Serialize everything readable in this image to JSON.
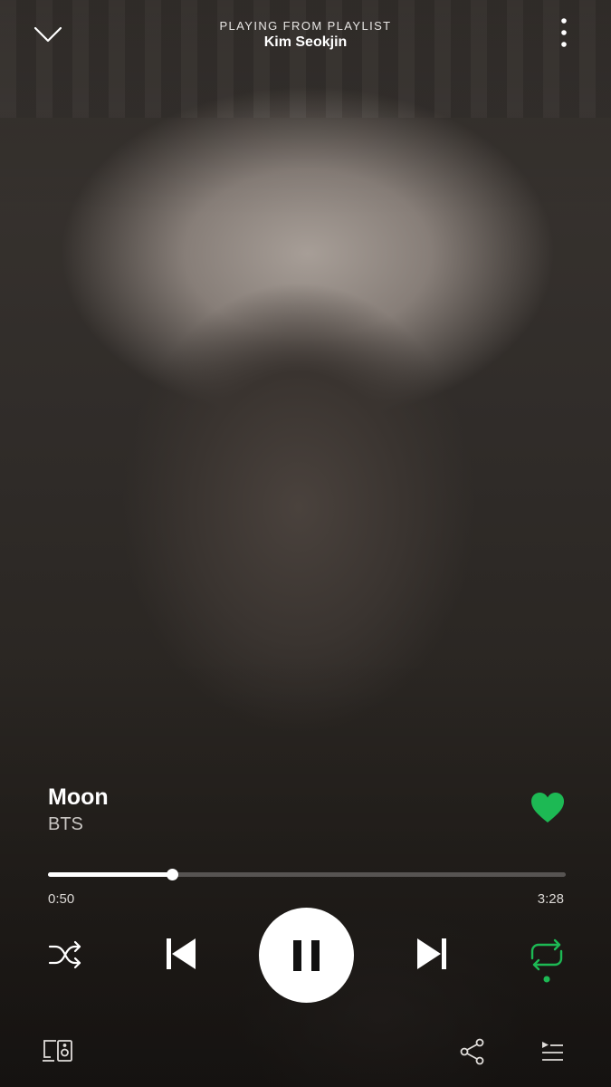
{
  "header": {
    "context_label": "PLAYING FROM PLAYLIST",
    "context_name": "Kim Seokjin",
    "collapse_icon": "chevron-down-icon",
    "menu_icon": "more-vertical-icon"
  },
  "track": {
    "title": "Moon",
    "artist": "BTS",
    "liked": true,
    "like_icon": "heart-icon"
  },
  "playback": {
    "elapsed": "0:50",
    "duration": "3:28",
    "progress_fraction": 0.24,
    "state": "playing",
    "shuffle": false,
    "repeat": true
  },
  "controls": {
    "shuffle_icon": "shuffle-icon",
    "prev_icon": "skip-previous-icon",
    "pause_icon": "pause-icon",
    "next_icon": "skip-next-icon",
    "repeat_icon": "repeat-icon"
  },
  "bottom": {
    "devices_icon": "devices-icon",
    "share_icon": "share-icon",
    "queue_icon": "queue-icon"
  },
  "colors": {
    "accent": "#1db954",
    "text": "#ffffff",
    "subtext": "#c9c6c3"
  }
}
